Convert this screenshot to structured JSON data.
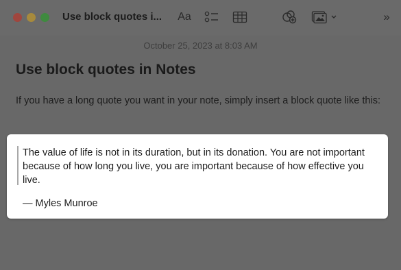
{
  "window": {
    "title": "Use block quotes i...",
    "traffic_lights": {
      "close_color": "#a0463e",
      "minimize_color": "#a78a3c",
      "zoom_color": "#3f8a3f"
    }
  },
  "toolbar": {
    "format_label": "Aa",
    "checklist_icon": "checklist-icon",
    "table_icon": "table-icon",
    "collaborate_icon": "collaborate-icon",
    "media_icon": "media-icon",
    "more_label": "»"
  },
  "note": {
    "date": "October 25, 2023 at 8:03 AM",
    "title": "Use block quotes in Notes",
    "body": "If you have a long quote you want in your note, simply insert a block quote like this:",
    "quote": {
      "text": "The value of life is not in its duration, but in its donation. You are not important because of how long you live, you are important because of how effective you live.",
      "author": "— Myles Munroe"
    }
  }
}
